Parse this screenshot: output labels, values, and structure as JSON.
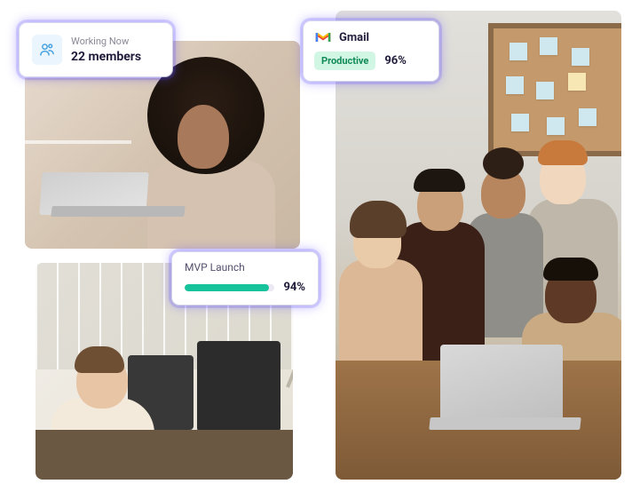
{
  "working_now": {
    "label": "Working Now",
    "value": "22 members",
    "icon": "people-icon"
  },
  "gmail_card": {
    "app_name": "Gmail",
    "badge_label": "Productive",
    "percent_text": "96%"
  },
  "mvp_card": {
    "title": "MVP Launch",
    "percent_text": "94%",
    "percent_value": 94
  },
  "colors": {
    "glow": "#5d54ff",
    "progress_fill": "#17c39a",
    "badge_bg": "#d2f6e4",
    "badge_text": "#0f8a56"
  },
  "images": {
    "top_left_alt": "Woman smiling while using a laptop",
    "bottom_left_alt": "Man working at desk with two monitors",
    "right_alt": "Group of five colleagues gathered around a laptop"
  }
}
